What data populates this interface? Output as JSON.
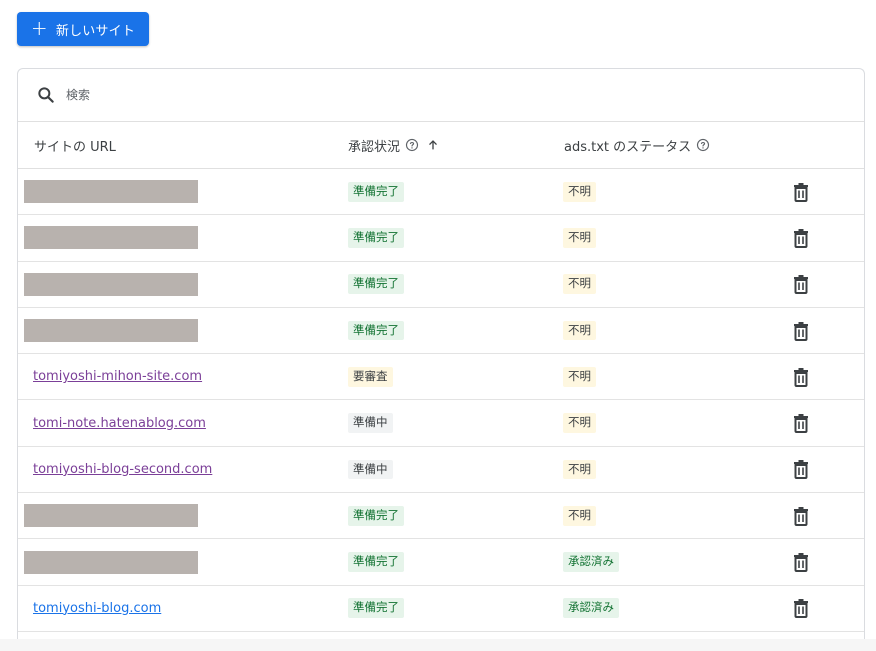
{
  "toolbar": {
    "new_site_label": "新しいサイト"
  },
  "search": {
    "placeholder": "検索"
  },
  "table": {
    "headers": {
      "url": "サイトの URL",
      "approval": "承認状況",
      "ads_txt": "ads.txt のステータス"
    },
    "rows": [
      {
        "url": "",
        "redacted": true,
        "approval": "準備完了",
        "ads_txt": "不明"
      },
      {
        "url": "",
        "redacted": true,
        "approval": "準備完了",
        "ads_txt": "不明"
      },
      {
        "url": "",
        "redacted": true,
        "approval": "準備完了",
        "ads_txt": "不明"
      },
      {
        "url": "",
        "redacted": true,
        "approval": "準備完了",
        "ads_txt": "不明"
      },
      {
        "url": "tomiyoshi-mihon-site.com",
        "redacted": false,
        "approval": "要審査",
        "ads_txt": "不明"
      },
      {
        "url": "tomi-note.hatenablog.com",
        "redacted": false,
        "approval": "準備中",
        "ads_txt": "不明"
      },
      {
        "url": "tomiyoshi-blog-second.com",
        "redacted": false,
        "approval": "準備中",
        "ads_txt": "不明"
      },
      {
        "url": "",
        "redacted": true,
        "approval": "準備完了",
        "ads_txt": "不明"
      },
      {
        "url": "",
        "redacted": true,
        "approval": "準備完了",
        "ads_txt": "承認済み"
      },
      {
        "url": "tomiyoshi-blog.com",
        "redacted": false,
        "approval": "準備完了",
        "ads_txt": "承認済み"
      }
    ]
  },
  "colors": {
    "primary": "#1a73e8",
    "link_visited": "#7b3f98",
    "link": "#1a73e8",
    "ready_bg": "#e6f4ea",
    "ready_text": "#137333",
    "warning_bg": "#fef7e0",
    "neutral_bg": "#f1f3f4"
  },
  "icons": {
    "add": "plus-icon",
    "search": "search-icon",
    "help": "help-circle-icon",
    "sort": "arrow-up-icon",
    "delete": "trash-icon"
  }
}
